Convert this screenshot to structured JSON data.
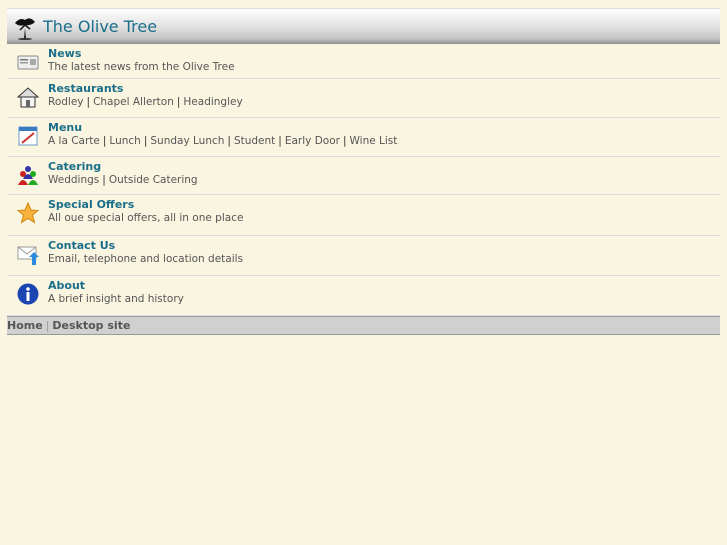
{
  "header": {
    "title": "The Olive Tree",
    "logo_icon": "olive-tree-icon"
  },
  "items": [
    {
      "title": "News",
      "icon": "newspaper-icon",
      "desc": "The latest news from the Olive Tree",
      "links": []
    },
    {
      "title": "Restaurants",
      "icon": "house-icon",
      "links": [
        "Rodley",
        "Chapel Allerton",
        "Headingley"
      ]
    },
    {
      "title": "Menu",
      "icon": "menu-icon",
      "links": [
        "A la Carte",
        "Lunch",
        "Sunday Lunch",
        "Student",
        "Early Door",
        "Wine List"
      ]
    },
    {
      "title": "Catering",
      "icon": "people-icon",
      "links": [
        "Weddings",
        "Outside Catering"
      ]
    },
    {
      "title": "Special Offers",
      "icon": "star-icon",
      "desc": "All oue special offers, all in one place",
      "links": []
    },
    {
      "title": "Contact Us",
      "icon": "mail-icon",
      "desc": "Email, telephone and location details",
      "links": []
    },
    {
      "title": "About",
      "icon": "info-icon",
      "desc": "A brief insight and history",
      "links": []
    }
  ],
  "footer": {
    "links": [
      "Home",
      "Desktop site"
    ],
    "separator": "|"
  },
  "colors": {
    "accent": "#1a6e8a",
    "background": "#faf5e0"
  }
}
